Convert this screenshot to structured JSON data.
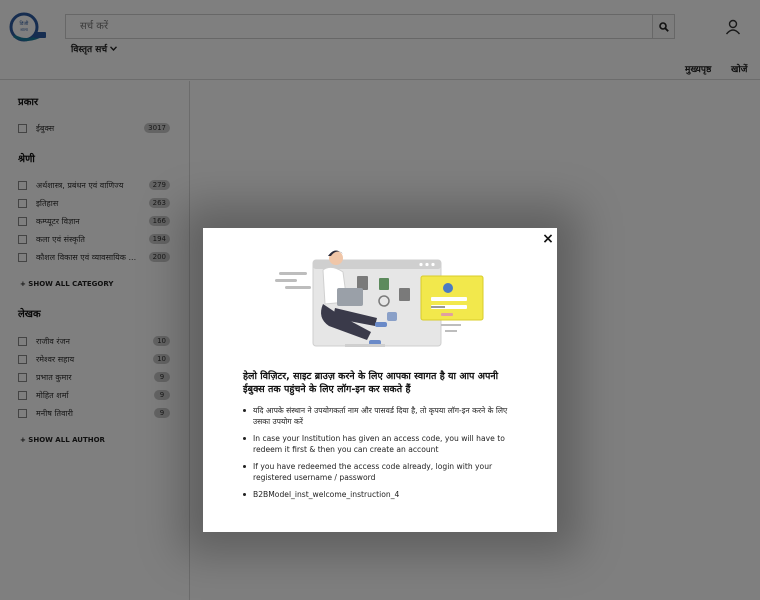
{
  "header": {
    "logo_text": "डिजी शाला",
    "search_placeholder": "सर्च करें",
    "advanced_search_label": "विस्तृत सर्च",
    "nav_home": "मुख्यपृष्ठ",
    "nav_browse": "खोजें"
  },
  "sidebar": {
    "type_section": {
      "title": "प्रकार",
      "items": [
        {
          "label": "ईबुक्स",
          "count": "3017"
        }
      ]
    },
    "category_section": {
      "title": "श्रेणी",
      "items": [
        {
          "label": "अर्थशास्त्र, प्रबंधन एवं वाणिज्य",
          "count": "279"
        },
        {
          "label": "इतिहास",
          "count": "263"
        },
        {
          "label": "कम्प्यूटर विज्ञान",
          "count": "166"
        },
        {
          "label": "कला एवं संस्कृति",
          "count": "194"
        },
        {
          "label": "कौशल विकास एवं व्यावसायिक ...",
          "count": "200"
        }
      ],
      "show_all": "+ SHOW ALL CATEGORY"
    },
    "author_section": {
      "title": "लेखक",
      "items": [
        {
          "label": "राजीव रंजन",
          "count": "10"
        },
        {
          "label": "रमेश्वर सहाय",
          "count": "10"
        },
        {
          "label": "प्रभात कुमार",
          "count": "9"
        },
        {
          "label": "मोहित शर्मा",
          "count": "9"
        },
        {
          "label": "मनीष तिवारी",
          "count": "9"
        }
      ],
      "show_all": "+ SHOW ALL AUTHOR"
    }
  },
  "modal": {
    "close_label": "×",
    "heading": "हेलो विज़िटर, साइट ब्राउज़ करने के लिए आपका स्वागत है या आप अपनी ईबुक्स तक पहुंचने के लिए लॉग-इन कर सकते हैं",
    "instructions": [
      "यदि आपके संस्थान ने उपयोगकर्ता नाम और पासवर्ड दिया है, तो कृपया लॉग-इन करने के लिए उसका उपयोग करें",
      "In case your Institution has given an access code, you will have to redeem it first & then you can create an account",
      "If you have redeemed the access code already, login with your registered username / password",
      "B2BModel_inst_welcome_instruction_4"
    ]
  },
  "colors": {
    "overlay": "#000000",
    "illustration_accent": "#f2e84c",
    "count_badge": "#c9c9c9"
  },
  "icons": {
    "search": "search-icon",
    "user": "user-icon",
    "close": "close-icon",
    "chevron": "chevron-down-icon"
  }
}
